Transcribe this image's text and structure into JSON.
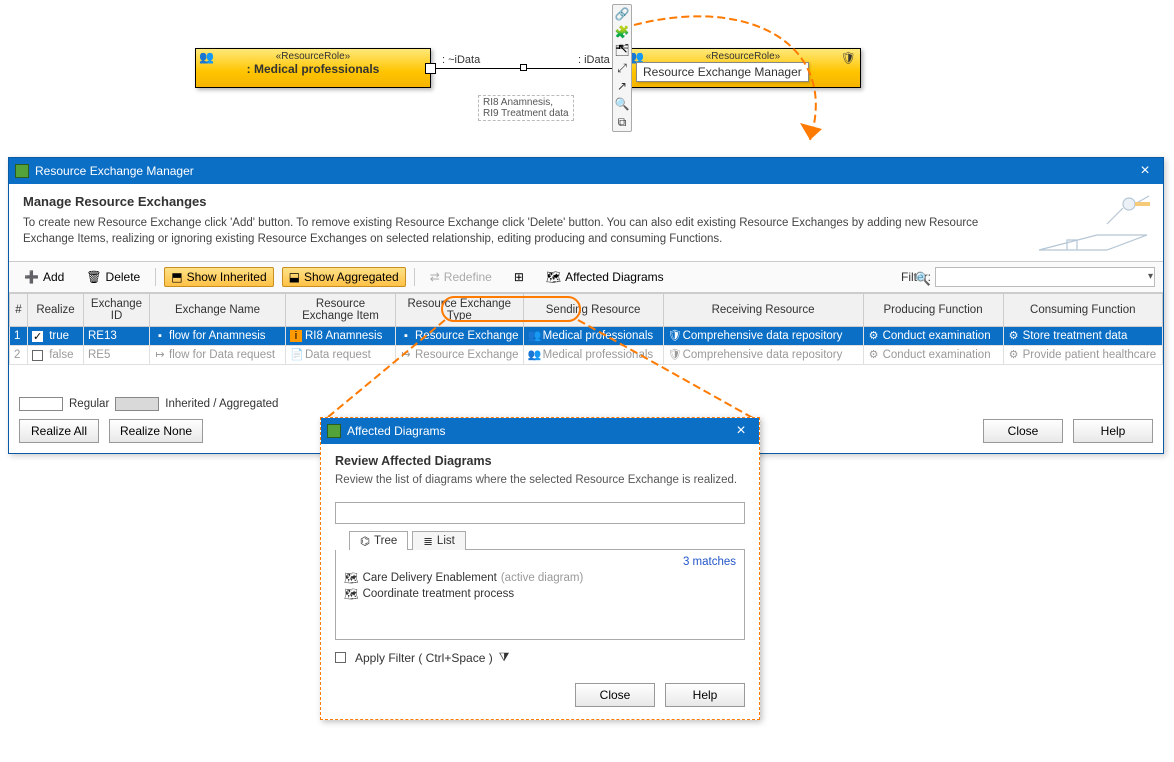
{
  "diagram": {
    "left_stereotype": "«ResourceRole»",
    "left_name": ": Medical professionals",
    "right_stereotype": "«ResourceRole»",
    "right_name": "",
    "port_out_label": ": ~iData",
    "port_in_label": ": iData",
    "flow_label_1": "RI8 Anamnesis,",
    "flow_label_2": "RI9 Treatment data",
    "tooltip": "Resource Exchange Manager"
  },
  "manager": {
    "title": "Resource Exchange Manager",
    "intro_heading": "Manage Resource Exchanges",
    "intro_text": "To create new Resource Exchange click 'Add' button. To remove existing Resource Exchange click 'Delete' button. You can also edit existing Resource Exchanges by adding new Resource Exchange Items, realizing or ignoring existing Resource Exchanges on selected relationship, editing producing and consuming Functions.",
    "toolbar": {
      "add": "Add",
      "delete": "Delete",
      "show_inherited": "Show Inherited",
      "show_aggregated": "Show Aggregated",
      "redefine": "Redefine",
      "affected": "Affected Diagrams"
    },
    "filter_label": "Filter:",
    "columns": {
      "num": "#",
      "realize": "Realize",
      "exid": "Exchange ID",
      "exname": "Exchange Name",
      "item": "Resource Exchange Item",
      "type": "Resource Exchange Type",
      "sending": "Sending Resource",
      "receiving": "Receiving Resource",
      "producing": "Producing Function",
      "consuming": "Consuming Function"
    },
    "rows": [
      {
        "num": "1",
        "realize": true,
        "realize_text": "true",
        "exid": "RE13",
        "exname": "flow for Anamnesis",
        "item": "RI8 Anamnesis",
        "type": "Resource Exchange",
        "sending": "Medical professionals",
        "receiving": "Comprehensive data repository",
        "producing": "Conduct examination",
        "consuming": "Store treatment data"
      },
      {
        "num": "2",
        "realize": false,
        "realize_text": "false",
        "exid": "RE5",
        "exname": "flow for Data request",
        "item": "Data request",
        "type": "Resource Exchange",
        "sending": "Medical professionals",
        "receiving": "Comprehensive data repository",
        "producing": "Conduct examination",
        "consuming": "Provide patient healthcare"
      }
    ],
    "legend_regular": "Regular",
    "legend_inherited": "Inherited / Aggregated",
    "realize_all": "Realize All",
    "realize_none": "Realize None",
    "close": "Close",
    "help": "Help"
  },
  "modal": {
    "title": "Affected Diagrams",
    "heading": "Review Affected Diagrams",
    "sub": "Review the list of diagrams where the selected Resource Exchange is realized.",
    "tab_tree": "Tree",
    "tab_list": "List",
    "matches": "3 matches",
    "items": [
      {
        "name": "Care Delivery Enablement",
        "suffix": "(active diagram)"
      },
      {
        "name": "Coordinate treatment process",
        "suffix": ""
      }
    ],
    "apply_filter": "Apply Filter ( Ctrl+Space )",
    "close": "Close",
    "help": "Help"
  }
}
